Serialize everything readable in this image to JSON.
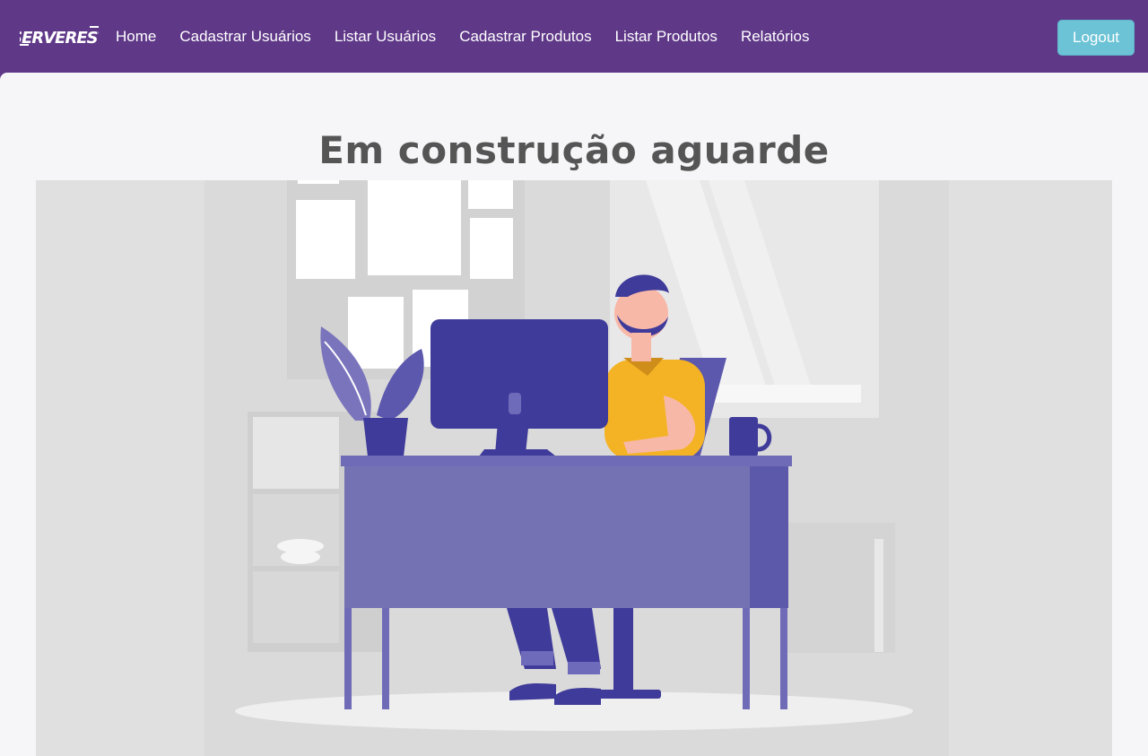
{
  "brand": {
    "name": "SERVEREST"
  },
  "nav": {
    "links": [
      {
        "label": "Home"
      },
      {
        "label": "Cadastrar Usuários"
      },
      {
        "label": "Listar Usuários"
      },
      {
        "label": "Cadastrar Produtos"
      },
      {
        "label": "Listar Produtos"
      },
      {
        "label": "Relatórios"
      }
    ],
    "logout_label": "Logout"
  },
  "main": {
    "title": "Em construção aguarde"
  },
  "colors": {
    "navbar": "#5f3888",
    "logout_button": "#6cc3d5",
    "page_background": "#f6f6f8",
    "title_text": "#555555",
    "illustration_background": "#e0e0e0"
  }
}
